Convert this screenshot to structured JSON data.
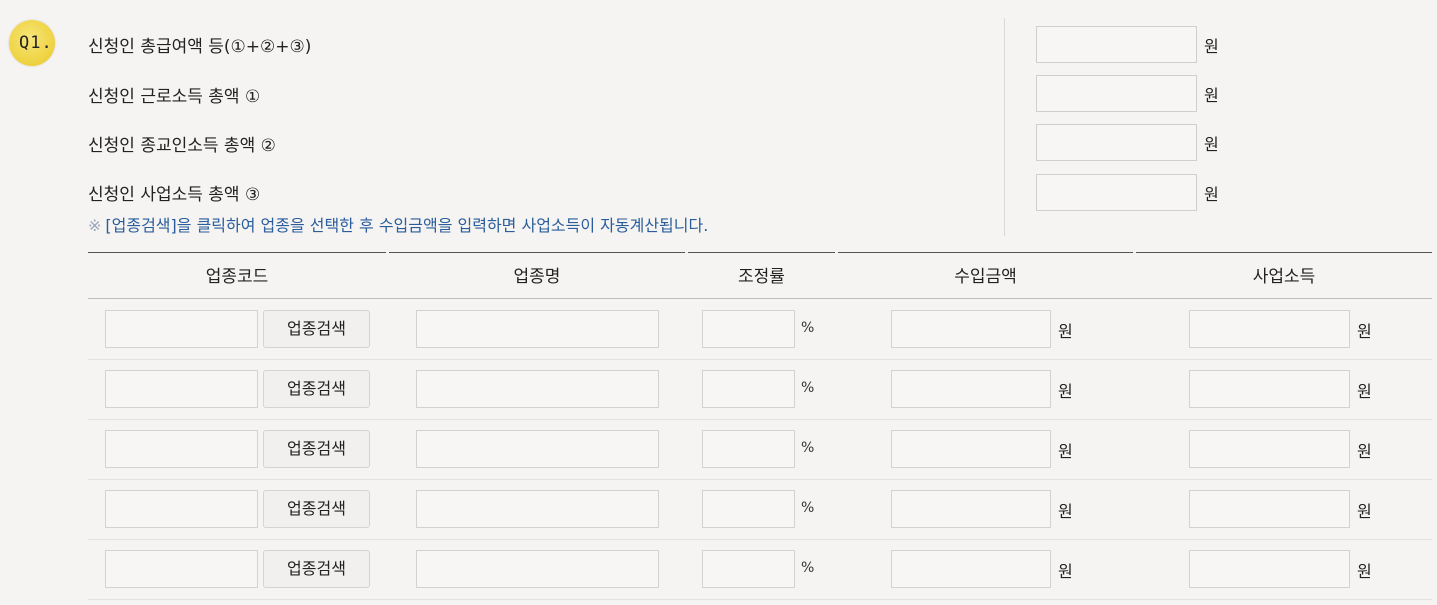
{
  "question": {
    "number": "Q1."
  },
  "summary": [
    {
      "label": "신청인 총급여액 등(①+②+③)",
      "value": "",
      "unit": "원"
    },
    {
      "label": "신청인 근로소득 총액 ①",
      "value": "",
      "unit": "원"
    },
    {
      "label": "신청인 종교인소득 총액 ②",
      "value": "",
      "unit": "원"
    },
    {
      "label": "신청인 사업소득 총액 ③",
      "value": "",
      "unit": "원"
    }
  ],
  "note": {
    "mark": "※",
    "text": "[업종검색]을 클릭하여 업종을 선택한 후 수입금액을 입력하면 사업소득이 자동계산됩니다."
  },
  "table": {
    "headers": [
      "업종코드",
      "업종명",
      "조정률",
      "수입금액",
      "사업소득"
    ],
    "search_button_label": "업종검색",
    "percent_unit": "%",
    "won_unit": "원",
    "rows": [
      {
        "code": "",
        "name": "",
        "rate": "",
        "revenue": "",
        "income": ""
      },
      {
        "code": "",
        "name": "",
        "rate": "",
        "revenue": "",
        "income": ""
      },
      {
        "code": "",
        "name": "",
        "rate": "",
        "revenue": "",
        "income": ""
      },
      {
        "code": "",
        "name": "",
        "rate": "",
        "revenue": "",
        "income": ""
      },
      {
        "code": "",
        "name": "",
        "rate": "",
        "revenue": "",
        "income": ""
      }
    ]
  }
}
